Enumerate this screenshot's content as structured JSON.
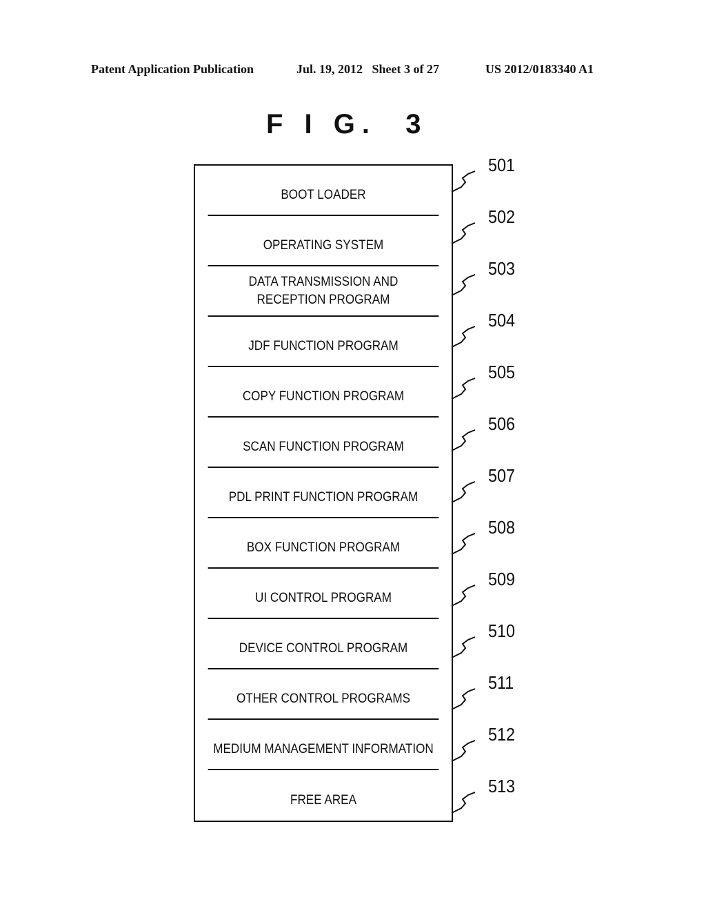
{
  "header": {
    "publication": "Patent Application Publication",
    "date_sheet": "Jul. 19, 2012   Sheet 3 of 27",
    "patent_number": "US 2012/0183340 A1"
  },
  "figure": {
    "title": "F I G.  3"
  },
  "layers": [
    {
      "label": "BOOT LOADER",
      "ref": "501"
    },
    {
      "label": "OPERATING SYSTEM",
      "ref": "502"
    },
    {
      "label": "DATA TRANSMISSION AND\nRECEPTION PROGRAM",
      "line1": "DATA TRANSMISSION AND",
      "line2": "RECEPTION PROGRAM",
      "ref": "503"
    },
    {
      "label": "JDF FUNCTION PROGRAM",
      "ref": "504"
    },
    {
      "label": "COPY FUNCTION PROGRAM",
      "ref": "505"
    },
    {
      "label": "SCAN FUNCTION PROGRAM",
      "ref": "506"
    },
    {
      "label": "PDL PRINT FUNCTION PROGRAM",
      "ref": "507"
    },
    {
      "label": "BOX FUNCTION PROGRAM",
      "ref": "508"
    },
    {
      "label": "UI CONTROL PROGRAM",
      "ref": "509"
    },
    {
      "label": "DEVICE CONTROL PROGRAM",
      "ref": "510"
    },
    {
      "label": "OTHER CONTROL PROGRAMS",
      "ref": "511"
    },
    {
      "label": "MEDIUM MANAGEMENT INFORMATION",
      "ref": "512"
    },
    {
      "label": "FREE AREA",
      "ref": "513"
    }
  ]
}
